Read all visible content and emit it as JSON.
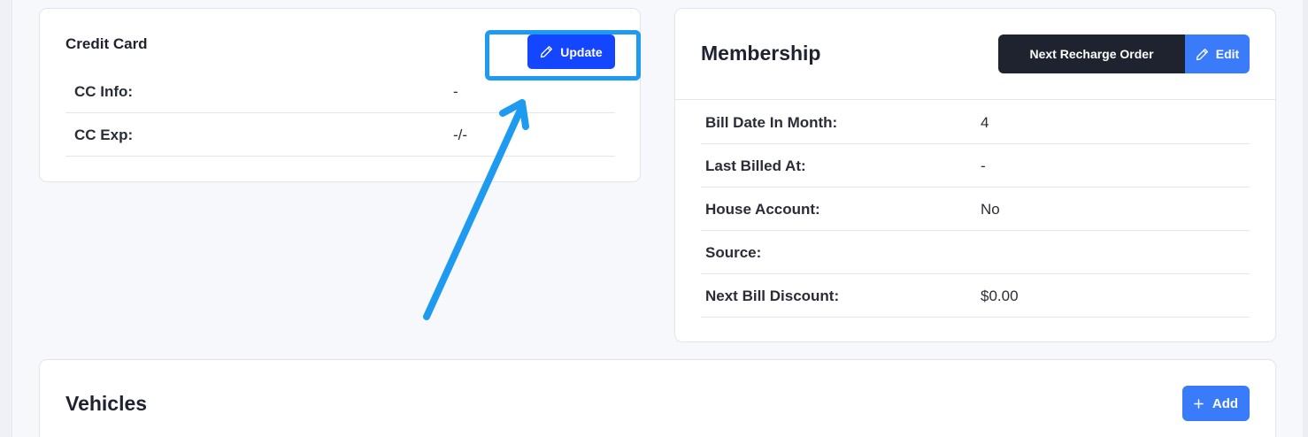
{
  "credit_card": {
    "title": "Credit Card",
    "update_label": "Update",
    "rows": [
      {
        "label": "CC Info:",
        "value": "-"
      },
      {
        "label": "CC Exp:",
        "value": "-/-"
      }
    ]
  },
  "membership": {
    "title": "Membership",
    "next_recharge_label": "Next Recharge Order",
    "edit_label": "Edit",
    "rows": [
      {
        "label": "Bill Date In Month:",
        "value": "4"
      },
      {
        "label": "Last Billed At:",
        "value": "-"
      },
      {
        "label": "House Account:",
        "value": "No"
      },
      {
        "label": "Source:",
        "value": ""
      },
      {
        "label": "Next Bill Discount:",
        "value": "$0.00"
      }
    ]
  },
  "vehicles": {
    "title": "Vehicles",
    "add_label": "Add"
  },
  "icons": {
    "update": "pencil-icon",
    "edit": "pencil-icon",
    "add": "plus-icon"
  },
  "colors": {
    "update_button": "#1546ff",
    "primary_button": "#3a7bfa",
    "dark_button": "#1f2330",
    "annotation": "#1e9af0"
  }
}
